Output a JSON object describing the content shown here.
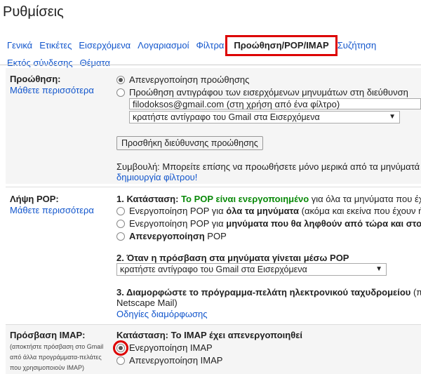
{
  "page_title": "Ρυθμίσεις",
  "tabs": [
    {
      "label": "Γενικά"
    },
    {
      "label": "Ετικέτες"
    },
    {
      "label": "Εισερχόμενα"
    },
    {
      "label": "Λογαριασμοί"
    },
    {
      "label": "Φίλτρα"
    },
    {
      "label": "Προώθηση/POP/IMAP",
      "active": true
    },
    {
      "label": "Συζήτηση"
    },
    {
      "label": "Εκτός σύνδεσης"
    },
    {
      "label": "Θέματα"
    }
  ],
  "forwarding": {
    "label": "Προώθηση:",
    "learn_more": "Μάθετε περισσότερα",
    "disable_option": "Απενεργοποίηση προώθησης",
    "forward_option": "Προώθηση αντιγράφου των εισερχόμενων μηνυμάτων στη διεύθυνση",
    "address_value": "filodoksos@gmail.com (στη χρήση από ένα φίλτρο)",
    "action_select": "κρατήστε αντίγραφο του Gmail στα Εισερχόμενα",
    "add_button": "Προσθήκη διεύθυνσης προώθησης",
    "tip_text": "Συμβουλή: Μπορείτε επίσης να προωθήσετε μόνο μερικά από τα μηνύματά σ",
    "tip_link": "δημιουργία φίλτρου!"
  },
  "pop": {
    "label": "Λήψη POP:",
    "learn_more": "Μάθετε περισσότερα",
    "status_prefix": "1. Κατάσταση: ",
    "status_value": "Το POP είναι ενεργοποιημένο",
    "status_suffix": " για όλα τα μηνύματα που έχ",
    "opt_all_pre": "Ενεργοποίηση POP για ",
    "opt_all_bold": "όλα τα μηνύματα",
    "opt_all_post": " (ακόμα και εκείνα που έχουν ή",
    "opt_now_pre": "Ενεργοποίηση POP για ",
    "opt_now_bold": "μηνύματα που θα ληφθούν από τώρα και στο",
    "opt_disable_bold": "Απενεργοποίηση",
    "opt_disable_post": " POP",
    "step2": "2. Όταν η πρόσβαση στα μηνύματα γίνεται μέσω POP",
    "step2_select": "κρατήστε αντίγραφο του Gmail στα Εισερχόμενα",
    "step3": "3. Διαμορφώστε το πρόγραμμα-πελάτη ηλεκτρονικού ταχυδρομείου",
    "step3_suffix": " (π.",
    "step3_line2": "Netscape Mail)",
    "config_link": "Οδηγίες διαμόρφωσης"
  },
  "imap": {
    "label": "Πρόσβαση IMAP:",
    "note": "(αποκτήστε πρόσβαση στο Gmail από άλλα προγράμματα-πελάτες που χρησιμοποιούν IMAP)",
    "status": "Κατάσταση: Το IMAP έχει απενεργοποιηθεί",
    "enable_option": "Ενεργοποίηση IMAP",
    "disable_option": "Απενεργοποίηση IMAP"
  },
  "colors": {
    "link": "#1155cc",
    "highlight": "#dd0000",
    "status_green": "#0a8a0a"
  }
}
